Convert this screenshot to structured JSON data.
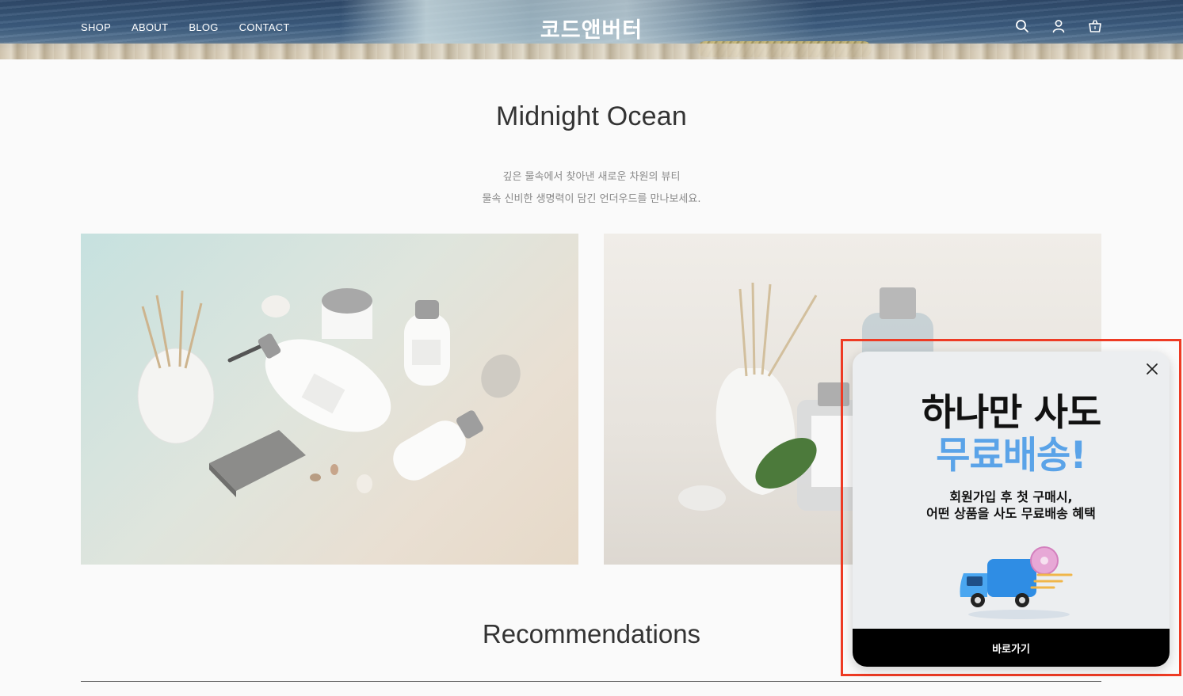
{
  "header": {
    "nav": [
      {
        "label": "SHOP"
      },
      {
        "label": "ABOUT"
      },
      {
        "label": "BLOG"
      },
      {
        "label": "CONTACT"
      }
    ],
    "logo": "코드앤버터",
    "icons": [
      "search-icon",
      "user-icon",
      "shopping-bag-icon"
    ]
  },
  "main": {
    "title": "Midnight Ocean",
    "description": [
      "깊은 물속에서 찾아낸 새로운 차원의 뷰티",
      "물속 신비한 생명력이 담긴 언더우드를 만나보세요."
    ],
    "section_title": "Recommendations"
  },
  "popup": {
    "headline_1": "하나만 사도",
    "headline_2": "무료배송!",
    "subtext_1": "회원가입 후 첫 구매시,",
    "subtext_2": "어떤 상품을 사도 무료배송 혜택",
    "button_label": "바로가기",
    "close_icon": "close-icon",
    "colors": {
      "accent": "#5aa3e8",
      "button": "#000000",
      "highlight_border": "#ee3b24"
    }
  }
}
